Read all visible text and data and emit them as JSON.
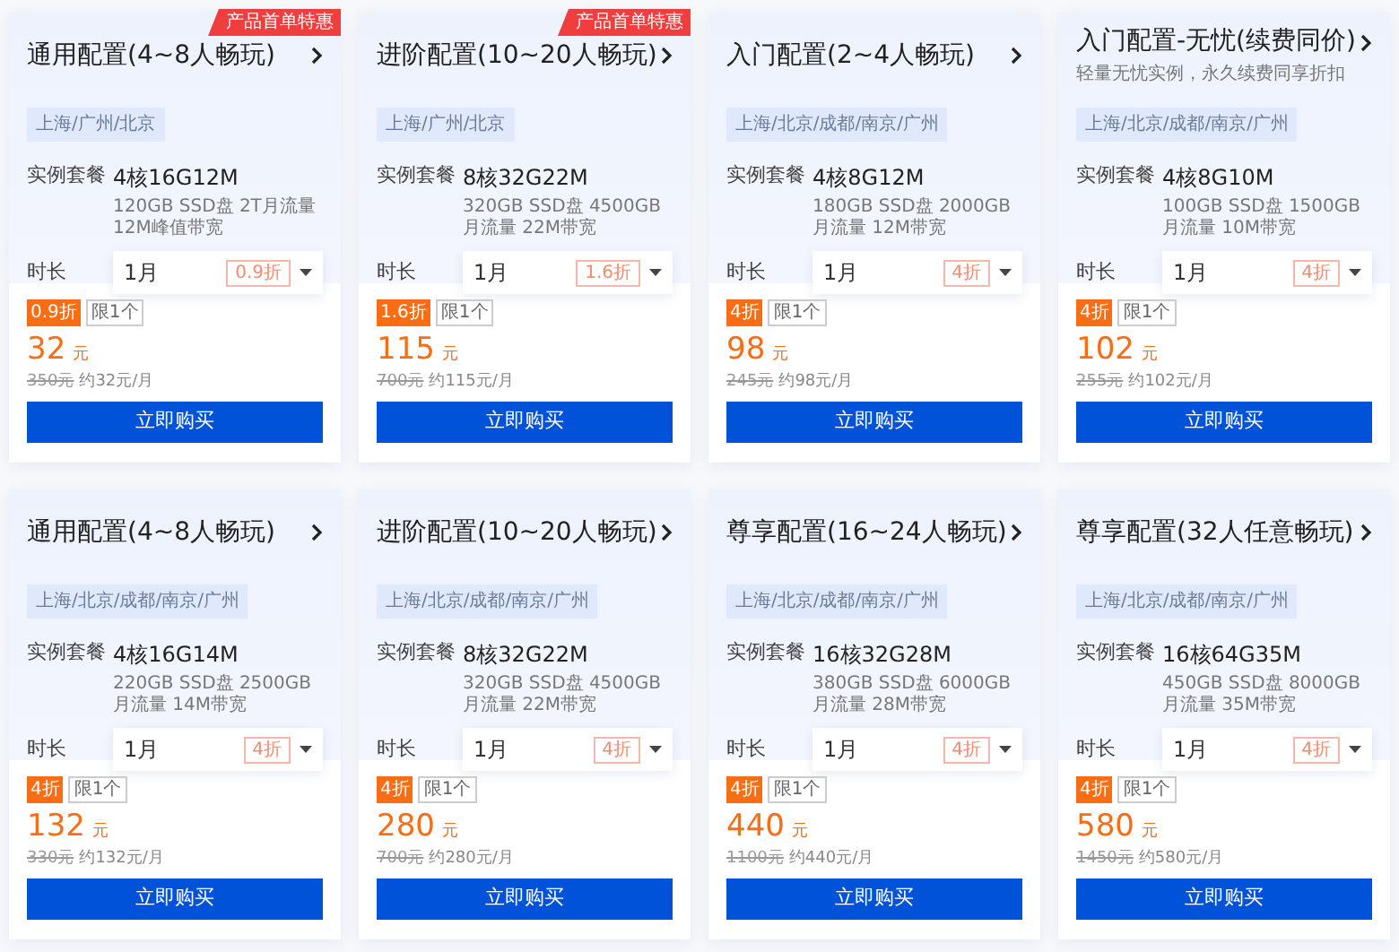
{
  "cards": [
    {
      "ribbon": "产品首单特惠",
      "title": "通用配置(4~8人畅玩)",
      "regions": "上海/广州/北京",
      "spec_label": "实例套餐",
      "spec": "4核16G12M",
      "spec_detail": "120GB SSD盘 2T月流量 12M峰值带宽",
      "duration_label": "时长",
      "duration": "1月",
      "duration_discount": "0.9折",
      "discount_badge": "0.9折",
      "limit_badge": "限1个",
      "price": "32",
      "unit": "元",
      "original_price": "350元",
      "monthly": "约32元/月",
      "button": "立即购买"
    },
    {
      "ribbon": "产品首单特惠",
      "title": "进阶配置(10~20人畅玩)",
      "regions": "上海/广州/北京",
      "spec_label": "实例套餐",
      "spec": "8核32G22M",
      "spec_detail": "320GB SSD盘 4500GB月流量 22M带宽",
      "duration_label": "时长",
      "duration": "1月",
      "duration_discount": "1.6折",
      "discount_badge": "1.6折",
      "limit_badge": "限1个",
      "price": "115",
      "unit": "元",
      "original_price": "700元",
      "monthly": "约115元/月",
      "button": "立即购买"
    },
    {
      "title": "入门配置(2~4人畅玩)",
      "regions": "上海/北京/成都/南京/广州",
      "spec_label": "实例套餐",
      "spec": "4核8G12M",
      "spec_detail": "180GB SSD盘 2000GB月流量 12M带宽",
      "duration_label": "时长",
      "duration": "1月",
      "duration_discount": "4折",
      "discount_badge": "4折",
      "limit_badge": "限1个",
      "price": "98",
      "unit": "元",
      "original_price": "245元",
      "monthly": "约98元/月",
      "button": "立即购买"
    },
    {
      "title": "入门配置-无忧(续费同价)",
      "subtitle": "轻量无忧实例，永久续费同享折扣",
      "regions": "上海/北京/成都/南京/广州",
      "spec_label": "实例套餐",
      "spec": "4核8G10M",
      "spec_detail": "100GB SSD盘 1500GB月流量 10M带宽",
      "duration_label": "时长",
      "duration": "1月",
      "duration_discount": "4折",
      "discount_badge": "4折",
      "limit_badge": "限1个",
      "price": "102",
      "unit": "元",
      "original_price": "255元",
      "monthly": "约102元/月",
      "button": "立即购买"
    },
    {
      "title": "通用配置(4~8人畅玩)",
      "regions": "上海/北京/成都/南京/广州",
      "spec_label": "实例套餐",
      "spec": "4核16G14M",
      "spec_detail": "220GB SSD盘 2500GB月流量 14M带宽",
      "duration_label": "时长",
      "duration": "1月",
      "duration_discount": "4折",
      "discount_badge": "4折",
      "limit_badge": "限1个",
      "price": "132",
      "unit": "元",
      "original_price": "330元",
      "monthly": "约132元/月",
      "button": "立即购买"
    },
    {
      "title": "进阶配置(10~20人畅玩)",
      "regions": "上海/北京/成都/南京/广州",
      "spec_label": "实例套餐",
      "spec": "8核32G22M",
      "spec_detail": "320GB SSD盘 4500GB月流量 22M带宽",
      "duration_label": "时长",
      "duration": "1月",
      "duration_discount": "4折",
      "discount_badge": "4折",
      "limit_badge": "限1个",
      "price": "280",
      "unit": "元",
      "original_price": "700元",
      "monthly": "约280元/月",
      "button": "立即购买"
    },
    {
      "title": "尊享配置(16~24人畅玩)",
      "regions": "上海/北京/成都/南京/广州",
      "spec_label": "实例套餐",
      "spec": "16核32G28M",
      "spec_detail": "380GB SSD盘 6000GB月流量 28M带宽",
      "duration_label": "时长",
      "duration": "1月",
      "duration_discount": "4折",
      "discount_badge": "4折",
      "limit_badge": "限1个",
      "price": "440",
      "unit": "元",
      "original_price": "1100元",
      "monthly": "约440元/月",
      "button": "立即购买"
    },
    {
      "title": "尊享配置(32人任意畅玩)",
      "regions": "上海/北京/成都/南京/广州",
      "spec_label": "实例套餐",
      "spec": "16核64G35M",
      "spec_detail": "450GB SSD盘 8000GB月流量 35M带宽",
      "duration_label": "时长",
      "duration": "1月",
      "duration_discount": "4折",
      "discount_badge": "4折",
      "limit_badge": "限1个",
      "price": "580",
      "unit": "元",
      "original_price": "1450元",
      "monthly": "约580元/月",
      "button": "立即购买"
    }
  ]
}
